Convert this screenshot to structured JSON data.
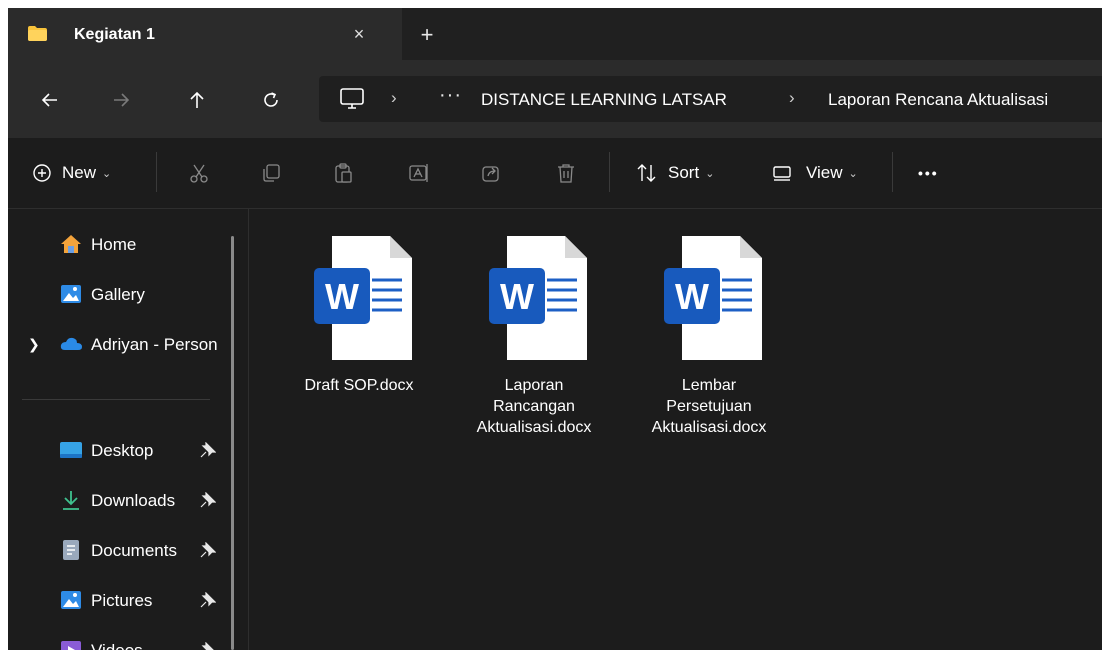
{
  "tab": {
    "title": "Kegiatan 1",
    "close_glyph": "×",
    "new_glyph": "+"
  },
  "breadcrumb": {
    "overflow": "···",
    "items": [
      "DISTANCE LEARNING LATSAR",
      "Laporan Rencana Aktualisasi"
    ],
    "separator": "›"
  },
  "toolbar": {
    "new_label": "New",
    "sort_label": "Sort",
    "view_label": "View",
    "more_glyph": "•••"
  },
  "sidebar": {
    "items": [
      {
        "label": "Home",
        "icon": "home-icon"
      },
      {
        "label": "Gallery",
        "icon": "gallery-icon"
      },
      {
        "label": "Adriyan - Person",
        "icon": "onedrive-icon"
      },
      {
        "label": "Desktop",
        "icon": "desktop-icon",
        "pinned": true
      },
      {
        "label": "Downloads",
        "icon": "downloads-icon",
        "pinned": true
      },
      {
        "label": "Documents",
        "icon": "documents-icon",
        "pinned": true
      },
      {
        "label": "Pictures",
        "icon": "pictures-icon",
        "pinned": true
      },
      {
        "label": "Videos",
        "icon": "videos-icon",
        "pinned": true
      }
    ]
  },
  "files": [
    {
      "name": "Draft SOP.docx",
      "icon": "word-document-icon"
    },
    {
      "name": "Laporan Rancangan Aktualisasi.docx",
      "icon": "word-document-icon"
    },
    {
      "name": "Lembar Persetujuan Aktualisasi.docx",
      "icon": "word-document-icon"
    }
  ],
  "colors": {
    "background": "#1c1c1c",
    "chrome": "#2b2b2b",
    "word_blue": "#185abd",
    "folder_yellow": "#f8c33b"
  }
}
